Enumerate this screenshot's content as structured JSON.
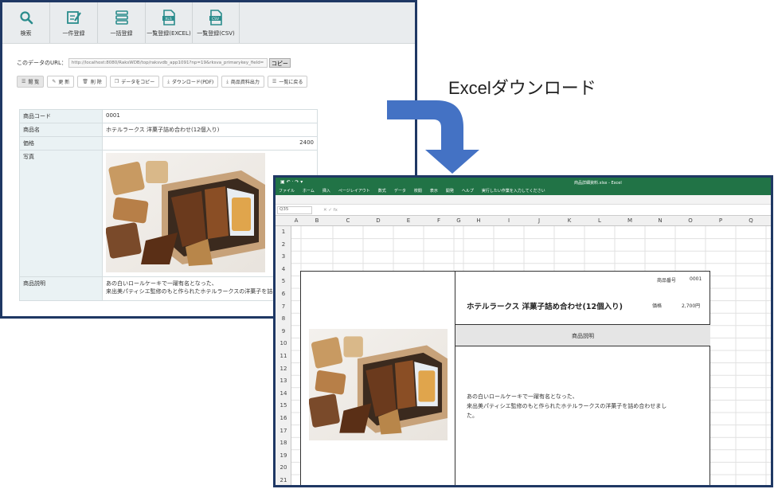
{
  "web": {
    "toolbar": [
      {
        "label": "検索",
        "icon": "search-icon"
      },
      {
        "label": "一件登録",
        "icon": "edit-icon"
      },
      {
        "label": "一括登録",
        "icon": "list-icon"
      },
      {
        "label": "一覧登録(EXCEL)",
        "icon": "excel-file-icon"
      },
      {
        "label": "一覧登録(CSV)",
        "icon": "csv-file-icon"
      }
    ],
    "url_label": "このデータのURL：",
    "url_value": "http://localhost:8080/RaksWDB/top/raksvdb_app1091?np=19&rksva_primarykey_field=",
    "copy_label": "コピー",
    "actions": [
      {
        "label": "閲 覧",
        "icon": "list-icon",
        "glyph": "☰"
      },
      {
        "label": "更 新",
        "icon": "pencil-icon",
        "glyph": "✎"
      },
      {
        "label": "削 除",
        "icon": "trash-icon",
        "glyph": "🗑"
      },
      {
        "label": "データをコピー",
        "icon": "copy-icon",
        "glyph": "❐"
      },
      {
        "label": "ダウンロード(PDF)",
        "icon": "download-icon",
        "glyph": "⤓"
      },
      {
        "label": "商品資料出力",
        "icon": "export-icon",
        "glyph": "⤓"
      },
      {
        "label": "一覧に戻る",
        "icon": "list-icon",
        "glyph": "☰"
      }
    ],
    "fields": {
      "code_label": "商品コード",
      "code_value": "0001",
      "name_label": "商品名",
      "name_value": "ホテルラークス 洋菓子詰め合わせ(12個入り)",
      "price_label": "価格",
      "price_value": "2400",
      "photo_label": "写真",
      "desc_label": "商品説明",
      "desc_line1": "あの白いロールケーキで一躍有名となった、",
      "desc_line2": "来出美パティシエ監修のもと作られたホテルラークスの洋菓子を詰め"
    }
  },
  "caption": "Excelダウンロード",
  "excel": {
    "filename": "商品詳細資料.xlsx - Excel",
    "ribbon_tabs": [
      "ファイル",
      "ホーム",
      "挿入",
      "ページレイアウト",
      "数式",
      "データ",
      "校閲",
      "表示",
      "開発",
      "ヘルプ",
      "実行したい作業を入力してください"
    ],
    "name_box": "Q35",
    "columns": [
      "A",
      "B",
      "C",
      "D",
      "E",
      "F",
      "G",
      "H",
      "I",
      "J",
      "K",
      "L",
      "M",
      "N",
      "O",
      "P",
      "Q"
    ],
    "rows": [
      "1",
      "2",
      "3",
      "4",
      "5",
      "6",
      "7",
      "8",
      "9",
      "10",
      "11",
      "12",
      "13",
      "14",
      "15",
      "16",
      "17",
      "18",
      "19",
      "20",
      "21"
    ],
    "sheet": {
      "no_label": "商品番号",
      "no_value": "0001",
      "title": "ホテルラークス 洋菓子詰め合わせ(12個入り)",
      "price_label": "価格",
      "price_value": "2,700円",
      "desc_header": "商品説明",
      "desc_line1": "あの白いロールケーキで一躍有名となった、",
      "desc_line2": "来出美パティシエ監修のもと作られたホテルラークスの洋菓子を詰め合わせまし",
      "desc_line3": "た。"
    }
  },
  "colors": {
    "frame": "#1f3864",
    "excel_green": "#217346",
    "arrow": "#4472c4",
    "accent_teal": "#2a8c8c"
  }
}
